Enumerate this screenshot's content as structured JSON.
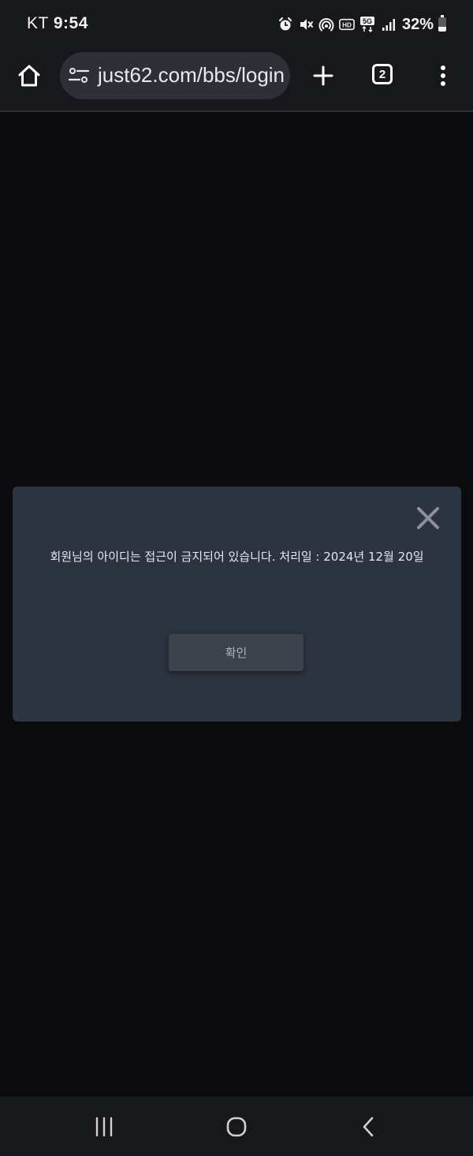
{
  "status_bar": {
    "carrier": "KT",
    "time": "9:54",
    "battery_percent": "32%",
    "icons": [
      "alarm-icon",
      "mute-icon",
      "hotspot-icon",
      "hd-voice-icon",
      "5g-icon",
      "signal-icon",
      "battery-icon"
    ]
  },
  "browser": {
    "url": "just62.com/bbs/login",
    "tab_count": "2",
    "icons": [
      "home-icon",
      "tune-icon",
      "plus-icon",
      "kebab-menu-icon"
    ]
  },
  "dialog": {
    "message": "회원님의 아이디는 접근이 금지되어 있습니다. 처리일 : 2024년 12월 20일",
    "confirm_label": "확인",
    "close_icon": "close-icon"
  },
  "nav_bar": {
    "icons": [
      "recent-apps-icon",
      "home-circle-icon",
      "back-icon"
    ]
  },
  "colors": {
    "page_background": "#0b0a0d",
    "chrome_background": "#17181c",
    "url_bar": "#2d3038",
    "dialog_background": "#2d3441",
    "button_background": "#3d424d"
  }
}
